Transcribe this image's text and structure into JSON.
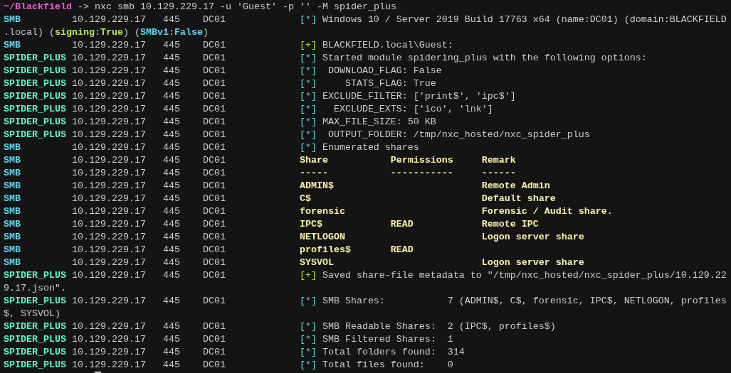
{
  "prompt": {
    "path": "~/Blackfield",
    "command": " -> nxc smb 10.129.229.17 -u 'Guest' -p '' -M spider_plus"
  },
  "rows": [
    {
      "kind": "info",
      "module": "SMB",
      "color": "#61d6f0",
      "host": "10.129.229.17",
      "port": "445",
      "name": "DC01",
      "marker": "[*]",
      "message": "Windows 10 / Server 2019 Build 17763 x64 (name:DC01) (domain:BLACKFIELD",
      "continuation": ".local) (**signing:True**) (**SMBv1:False**)"
    },
    {
      "kind": "success",
      "module": "SMB",
      "color": "#61d6f0",
      "host": "10.129.229.17",
      "port": "445",
      "name": "DC01",
      "marker": "[+]",
      "message": "BLACKFIELD.local\\Guest:"
    },
    {
      "kind": "info",
      "module": "SPIDER_PLUS",
      "color": "#5ff5c8",
      "host": "10.129.229.17",
      "port": "445",
      "name": "DC01",
      "marker": "[*]",
      "message": "Started module spidering_plus with the following options:"
    },
    {
      "kind": "info",
      "module": "SPIDER_PLUS",
      "color": "#5ff5c8",
      "host": "10.129.229.17",
      "port": "445",
      "name": "DC01",
      "marker": "[*]",
      "message": " DOWNLOAD_FLAG: False"
    },
    {
      "kind": "info",
      "module": "SPIDER_PLUS",
      "color": "#5ff5c8",
      "host": "10.129.229.17",
      "port": "445",
      "name": "DC01",
      "marker": "[*]",
      "message": "    STATS_FLAG: True"
    },
    {
      "kind": "info",
      "module": "SPIDER_PLUS",
      "color": "#5ff5c8",
      "host": "10.129.229.17",
      "port": "445",
      "name": "DC01",
      "marker": "[*]",
      "message": "EXCLUDE_FILTER: ['print$', 'ipc$']"
    },
    {
      "kind": "info",
      "module": "SPIDER_PLUS",
      "color": "#5ff5c8",
      "host": "10.129.229.17",
      "port": "445",
      "name": "DC01",
      "marker": "[*]",
      "message": "  EXCLUDE_EXTS: ['ico', 'lnk']"
    },
    {
      "kind": "info",
      "module": "SPIDER_PLUS",
      "color": "#5ff5c8",
      "host": "10.129.229.17",
      "port": "445",
      "name": "DC01",
      "marker": "[*]",
      "message": "MAX_FILE_SIZE: 50 KB"
    },
    {
      "kind": "info",
      "module": "SPIDER_PLUS",
      "color": "#5ff5c8",
      "host": "10.129.229.17",
      "port": "445",
      "name": "DC01",
      "marker": "[*]",
      "message": " OUTPUT_FOLDER: /tmp/nxc_hosted/nxc_spider_plus"
    },
    {
      "kind": "info",
      "module": "SMB",
      "color": "#61d6f0",
      "host": "10.129.229.17",
      "port": "445",
      "name": "DC01",
      "marker": "[*]",
      "message": "Enumerated shares"
    },
    {
      "kind": "share",
      "module": "SMB",
      "color": "#61d6f0",
      "host": "10.129.229.17",
      "port": "445",
      "name": "DC01",
      "share": "Share",
      "permissions": "Permissions",
      "remark": "Remark"
    },
    {
      "kind": "share",
      "module": "SMB",
      "color": "#61d6f0",
      "host": "10.129.229.17",
      "port": "445",
      "name": "DC01",
      "share": "-----",
      "permissions": "-----------",
      "remark": "------"
    },
    {
      "kind": "share",
      "module": "SMB",
      "color": "#61d6f0",
      "host": "10.129.229.17",
      "port": "445",
      "name": "DC01",
      "share": "ADMIN$",
      "remark": "Remote Admin"
    },
    {
      "kind": "share",
      "module": "SMB",
      "color": "#61d6f0",
      "host": "10.129.229.17",
      "port": "445",
      "name": "DC01",
      "share": "C$",
      "remark": "Default share"
    },
    {
      "kind": "share",
      "module": "SMB",
      "color": "#61d6f0",
      "host": "10.129.229.17",
      "port": "445",
      "name": "DC01",
      "share": "forensic",
      "remark": "Forensic / Audit share."
    },
    {
      "kind": "share",
      "module": "SMB",
      "color": "#61d6f0",
      "host": "10.129.229.17",
      "port": "445",
      "name": "DC01",
      "share": "IPC$",
      "permissions": "READ",
      "remark": "Remote IPC"
    },
    {
      "kind": "share",
      "module": "SMB",
      "color": "#61d6f0",
      "host": "10.129.229.17",
      "port": "445",
      "name": "DC01",
      "share": "NETLOGON",
      "remark": "Logon server share"
    },
    {
      "kind": "share",
      "module": "SMB",
      "color": "#61d6f0",
      "host": "10.129.229.17",
      "port": "445",
      "name": "DC01",
      "share": "profiles$",
      "permissions": "READ"
    },
    {
      "kind": "share",
      "module": "SMB",
      "color": "#61d6f0",
      "host": "10.129.229.17",
      "port": "445",
      "name": "DC01",
      "share": "SYSVOL",
      "remark": "Logon server share"
    },
    {
      "kind": "success",
      "module": "SPIDER_PLUS",
      "color": "#5ff5c8",
      "host": "10.129.229.17",
      "port": "445",
      "name": "DC01",
      "marker": "[+]",
      "message": "Saved share-file metadata to \"/tmp/nxc_hosted/nxc_spider_plus/10.129.22",
      "continuation": "9.17.json\"."
    },
    {
      "kind": "info",
      "module": "SPIDER_PLUS",
      "color": "#5ff5c8",
      "host": "10.129.229.17",
      "port": "445",
      "name": "DC01",
      "marker": "[*]",
      "message": "SMB Shares:           7 (ADMIN$, C$, forensic, IPC$, NETLOGON, profiles",
      "continuation": "$, SYSVOL)"
    },
    {
      "kind": "info",
      "module": "SPIDER_PLUS",
      "color": "#5ff5c8",
      "host": "10.129.229.17",
      "port": "445",
      "name": "DC01",
      "marker": "[*]",
      "message": "SMB Readable Shares:  2 (IPC$, profiles$)"
    },
    {
      "kind": "info",
      "module": "SPIDER_PLUS",
      "color": "#5ff5c8",
      "host": "10.129.229.17",
      "port": "445",
      "name": "DC01",
      "marker": "[*]",
      "message": "SMB Filtered Shares:  1"
    },
    {
      "kind": "info",
      "module": "SPIDER_PLUS",
      "color": "#5ff5c8",
      "host": "10.129.229.17",
      "port": "445",
      "name": "DC01",
      "marker": "[*]",
      "message": "Total folders found:  314"
    },
    {
      "kind": "info",
      "module": "SPIDER_PLUS",
      "color": "#5ff5c8",
      "host": "10.129.229.17",
      "port": "445",
      "name": "DC01",
      "marker": "[*]",
      "message": "Total files found:    0"
    }
  ]
}
